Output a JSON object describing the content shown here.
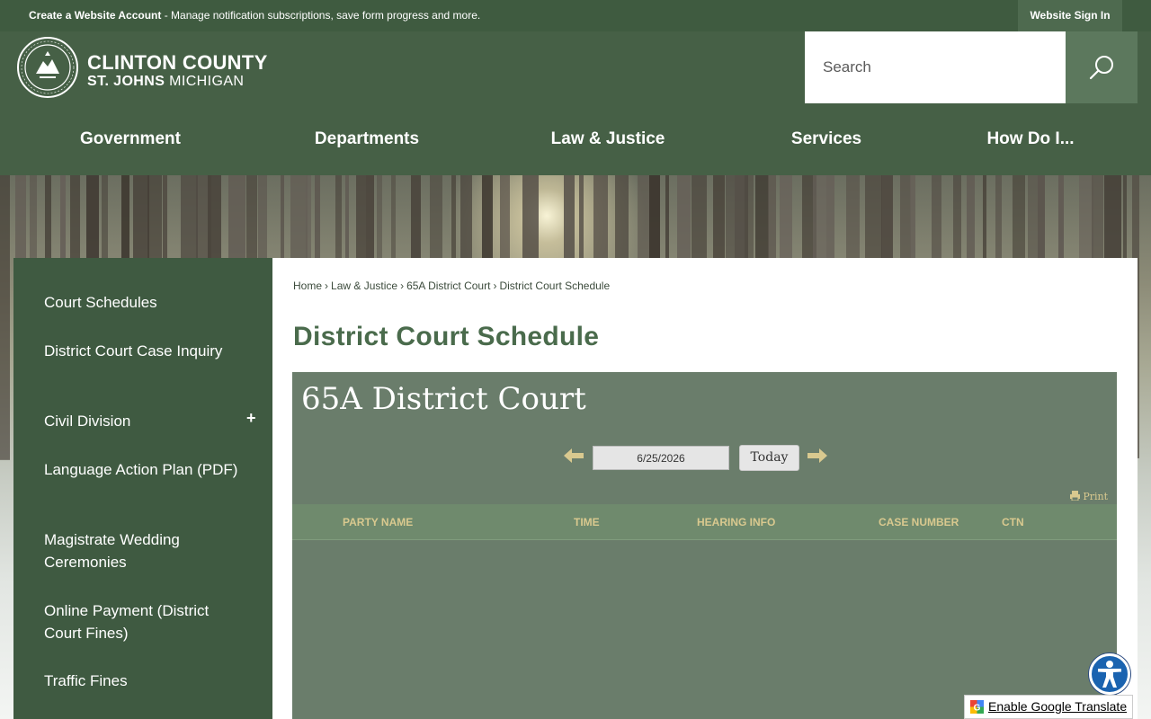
{
  "topbar": {
    "account_link": "Create a Website Account",
    "account_desc": " - Manage notification subscriptions, save form progress and more.",
    "signin": "Website Sign In"
  },
  "header": {
    "county": "CLINTON COUNTY",
    "city": "ST. JOHNS",
    "state": " MICHIGAN",
    "search_placeholder": "Search"
  },
  "nav": [
    {
      "label": "Government"
    },
    {
      "label": "Departments"
    },
    {
      "label": "Law & Justice"
    },
    {
      "label": "Services"
    },
    {
      "label": "How Do I..."
    }
  ],
  "sidebar": {
    "items": [
      {
        "label": "Court Schedules"
      },
      {
        "label": "District Court Case Inquiry"
      },
      {
        "label": "Civil Division",
        "expand": "+"
      },
      {
        "label": "Language Action Plan (PDF)"
      },
      {
        "label": "Magistrate Wedding Ceremonies"
      },
      {
        "label": "Online Payment (District Court Fines)"
      },
      {
        "label": "Traffic Fines"
      }
    ]
  },
  "breadcrumb": [
    "Home",
    "Law & Justice",
    "65A District Court",
    "District Court Schedule"
  ],
  "breadcrumb_sep": "›",
  "page_title": "District Court Schedule",
  "court": {
    "title": "65A District Court",
    "date": "6/25/2026",
    "today": "Today",
    "print": "Print",
    "columns": [
      "PARTY NAME",
      "TIME",
      "HEARING INFO",
      "CASE NUMBER",
      "CTN"
    ]
  },
  "translate": "Enable Google Translate",
  "colors": {
    "topbar": "#3f5b40",
    "header": "#466046",
    "sidebar": "#3f5a41",
    "title_green": "#4a6b4c",
    "court_panel": "#6a7d6b",
    "column_text": "#d9c98f"
  }
}
